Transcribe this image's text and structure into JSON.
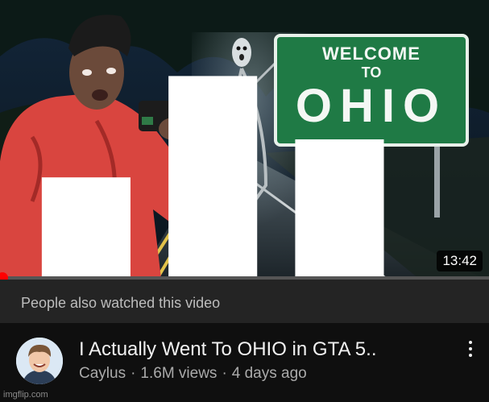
{
  "video": {
    "sign_line1": "WELCOME",
    "sign_line2": "TO",
    "sign_line3": "OHIO",
    "duration": "13:42",
    "progress_percent": 1
  },
  "also_watched": {
    "label": "People also watched this video"
  },
  "meta": {
    "title": "I Actually Went To OHIO in GTA 5..",
    "channel": "Caylus",
    "views": "1.6M views",
    "age": "4 days ago",
    "separator": "·"
  },
  "watermark": "imgflip.com",
  "icons": {
    "bars": "audio-bars-icon",
    "menu": "more-vertical-icon"
  },
  "colors": {
    "progress": "#ff0000",
    "sign_green": "#1f7a45"
  }
}
